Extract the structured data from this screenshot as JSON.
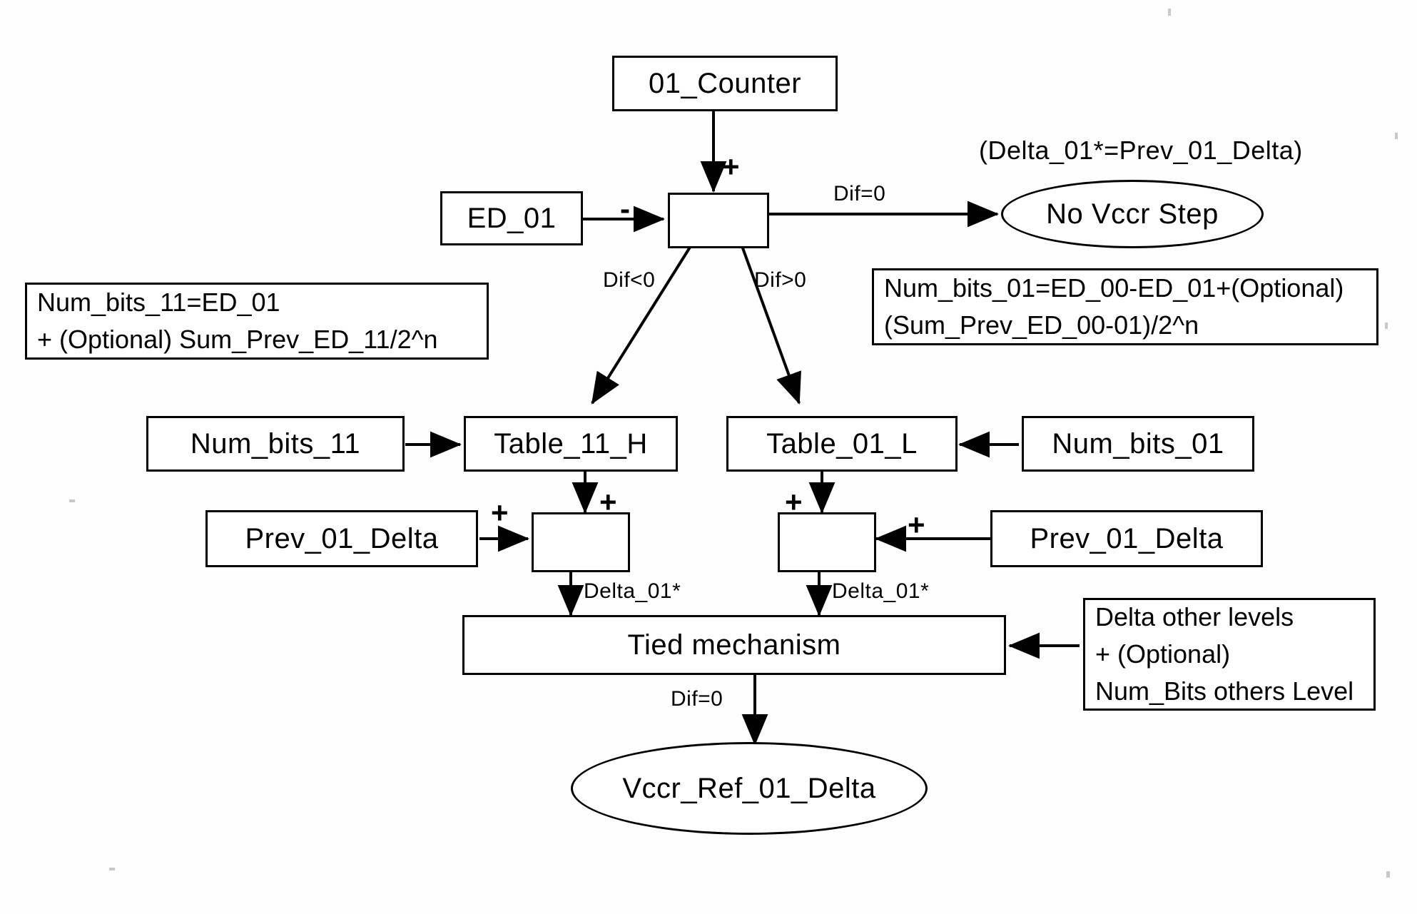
{
  "diagram": {
    "title_hidden": "",
    "nodes": {
      "counter": "01_Counter",
      "ed01": "ED_01",
      "junction_top": "",
      "no_vccr_step": "No Vccr Step",
      "table_11_h": "Table_11_H",
      "table_01_l": "Table_01_L",
      "num_bits_11": "Num_bits_11",
      "num_bits_01": "Num_bits_01",
      "prev_01_delta_left": "Prev_01_Delta",
      "prev_01_delta_right": "Prev_01_Delta",
      "sum_left": "",
      "sum_right": "",
      "tied_mechanism": "Tied mechanism",
      "vccr_ref": "Vccr_Ref_01_Delta"
    },
    "notes": {
      "left_note": {
        "line1": "Num_bits_11=ED_01",
        "line2": "+ (Optional) Sum_Prev_ED_11/2^n"
      },
      "right_note": {
        "line1": "Num_bits_01=ED_00-ED_01+(Optional)",
        "line2": "(Sum_Prev_ED_00-01)/2^n"
      },
      "delta_other_note": {
        "line1": "Delta other levels",
        "line2": "+ (Optional)",
        "line3": "Num_Bits others Level"
      },
      "delta_equals": "(Delta_01*=Prev_01_Delta)"
    },
    "edge_labels": {
      "plus_counter": "+",
      "minus_ed01": "-",
      "dif_eq_zero_top": "Dif=0",
      "dif_lt_zero": "Dif<0",
      "dif_gt_zero": "Dif>0",
      "plus_table11": "+",
      "plus_prev_left": "+",
      "plus_table01": "+",
      "plus_prev_right": "+",
      "delta_01_star_left": "Delta_01*",
      "delta_01_star_right": "Delta_01*",
      "dif_eq_zero_bottom": "Dif=0"
    },
    "colors": {
      "stroke": "#000000",
      "background": "#ffffff",
      "fill": "#ffffff"
    }
  }
}
